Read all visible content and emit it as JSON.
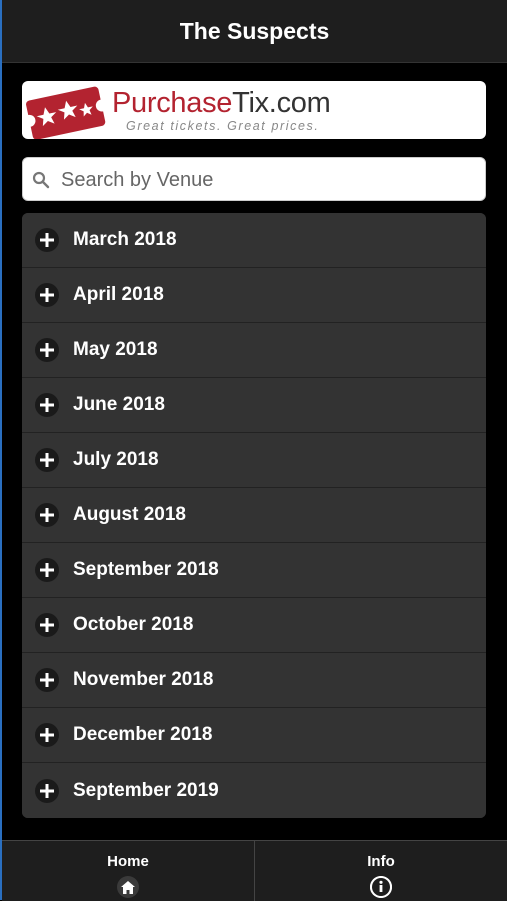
{
  "header": {
    "title": "The Suspects"
  },
  "banner": {
    "brand_part1": "Purchase",
    "brand_part2": "Tix.com",
    "tagline": "Great tickets. Great prices."
  },
  "search": {
    "placeholder": "Search by Venue",
    "icon": "search-icon"
  },
  "months": [
    {
      "label": "March 2018"
    },
    {
      "label": "April 2018"
    },
    {
      "label": "May 2018"
    },
    {
      "label": "June 2018"
    },
    {
      "label": "July 2018"
    },
    {
      "label": "August 2018"
    },
    {
      "label": "September 2018"
    },
    {
      "label": "October 2018"
    },
    {
      "label": "November 2018"
    },
    {
      "label": "December 2018"
    },
    {
      "label": "September 2019"
    }
  ],
  "footer": {
    "home_label": "Home",
    "home_icon": "home-icon",
    "info_label": "Info",
    "info_icon": "info-icon"
  },
  "colors": {
    "brand_red": "#b32330",
    "background": "#000000",
    "list_bg": "#333333"
  }
}
